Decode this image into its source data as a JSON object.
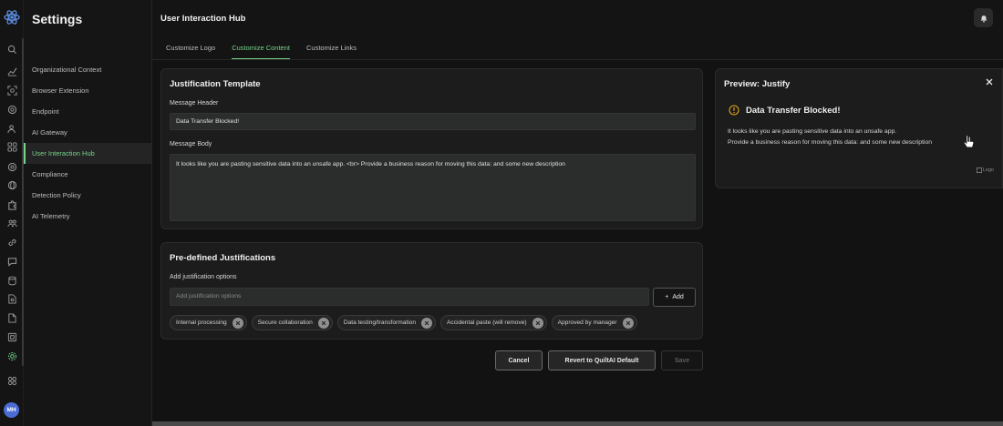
{
  "sidebar": {
    "title": "Settings",
    "items": [
      {
        "label": "Organizational Context"
      },
      {
        "label": "Browser Extension"
      },
      {
        "label": "Endpoint"
      },
      {
        "label": "AI Gateway"
      },
      {
        "label": "User Interaction Hub"
      },
      {
        "label": "Compliance"
      },
      {
        "label": "Detection Policy"
      },
      {
        "label": "AI Telemetry"
      }
    ],
    "active_index": 4
  },
  "rail": {
    "icons": [
      "search-icon",
      "chart-icon",
      "scan-icon",
      "target-icon",
      "users-icon",
      "grid-icon",
      "at-icon",
      "globe-icon",
      "puzzle-icon",
      "people-icon",
      "link-icon",
      "chat-icon",
      "database-icon",
      "file-search-icon",
      "file-icon",
      "frame-icon",
      "gear-icon"
    ],
    "apps_icon": "apps-icon",
    "avatar_initials": "MH",
    "accent": "#76d48b"
  },
  "header": {
    "title": "User Interaction Hub",
    "tabs": [
      "Customize Logo",
      "Customize Content",
      "Customize Links"
    ],
    "active_tab": 1
  },
  "template": {
    "title": "Justification Template",
    "header_label": "Message Header",
    "header_value": "Data Transfer Blocked!",
    "body_label": "Message Body",
    "body_value": "It looks like you are pasting sensitive data into an unsafe app. <br> Provide a business reason for moving this data: and some new description"
  },
  "predefined": {
    "title": "Pre-defined Justifications",
    "add_label": "Add justification options",
    "input_placeholder": "Add justification options",
    "add_button": "Add",
    "chips": [
      "Internal processing",
      "Secure collaboration",
      "Data testing/transformation",
      "Accidental paste (will remove)",
      "Approved by manager"
    ]
  },
  "actions": {
    "cancel": "Cancel",
    "revert": "Revert to QuiltAI Default",
    "save": "Save"
  },
  "preview": {
    "title": "Preview: Justify",
    "heading": "Data Transfer Blocked!",
    "line1": "It looks like you are pasting sensitive data into an unsafe app.",
    "line2": "Provide a business reason for moving this data: and some new description",
    "logo_alt": "Logo",
    "warn_color": "#e0a21b"
  }
}
